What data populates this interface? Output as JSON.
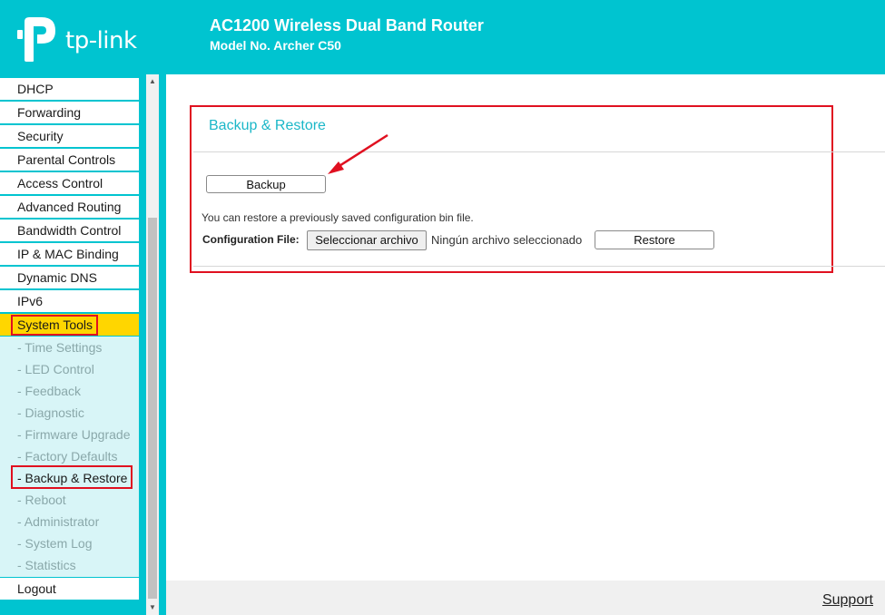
{
  "header": {
    "logo_text": "tp-link",
    "title": "AC1200 Wireless Dual Band Router",
    "model": "Model No. Archer C50"
  },
  "sidebar": {
    "items": [
      {
        "label": "DHCP"
      },
      {
        "label": "Forwarding"
      },
      {
        "label": "Security"
      },
      {
        "label": "Parental Controls"
      },
      {
        "label": "Access Control"
      },
      {
        "label": "Advanced Routing"
      },
      {
        "label": "Bandwidth Control"
      },
      {
        "label": "IP & MAC Binding"
      },
      {
        "label": "Dynamic DNS"
      },
      {
        "label": "IPv6"
      },
      {
        "label": "System Tools"
      }
    ],
    "subitems": [
      {
        "label": "- Time Settings"
      },
      {
        "label": "- LED Control"
      },
      {
        "label": "- Feedback"
      },
      {
        "label": "- Diagnostic"
      },
      {
        "label": "- Firmware Upgrade"
      },
      {
        "label": "- Factory Defaults"
      },
      {
        "label": "- Backup & Restore"
      },
      {
        "label": "- Reboot"
      },
      {
        "label": "- Administrator"
      },
      {
        "label": "- System Log"
      },
      {
        "label": "- Statistics"
      }
    ],
    "logout": "Logout",
    "active_section": "System Tools",
    "current_page": "- Backup & Restore"
  },
  "panel": {
    "title": "Backup & Restore",
    "backup_label": "Backup",
    "description": "You can restore a previously saved configuration bin file.",
    "config_label": "Configuration File:",
    "choose_file_label": "Seleccionar archivo",
    "file_status": "Ningún archivo seleccionado",
    "restore_label": "Restore"
  },
  "footer": {
    "support_label": "Support"
  },
  "colors": {
    "brand": "#00c4d0",
    "active_menu": "#ffd600",
    "highlight": "#e01020",
    "panel_title": "#1bb7c8"
  }
}
